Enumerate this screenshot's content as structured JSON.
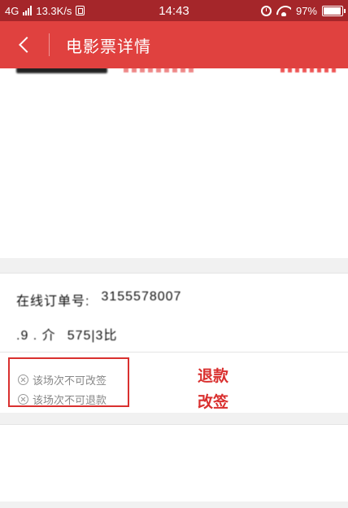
{
  "status_bar": {
    "network": "4G",
    "speed": "13.3K/s",
    "time": "14:43",
    "battery": "97%",
    "battery_level": 0.97,
    "icons": [
      "signal-icon",
      "sim-icon",
      "alarm-icon",
      "wifi-icon",
      "battery-icon"
    ]
  },
  "header": {
    "title": "电影票详情",
    "background": "#e0413f",
    "back_icon": "chevron-left-icon"
  },
  "order": {
    "row1_label": "在线订单号:",
    "row1_value": "3155578007",
    "row2_label": ".9 . 介",
    "row2_value": "575|3比"
  },
  "policy": {
    "items": [
      "该场次不可改签",
      "该场次不可退款"
    ],
    "annotation_refund": "退款",
    "annotation_change": "改签",
    "accent": "#d9302f"
  }
}
